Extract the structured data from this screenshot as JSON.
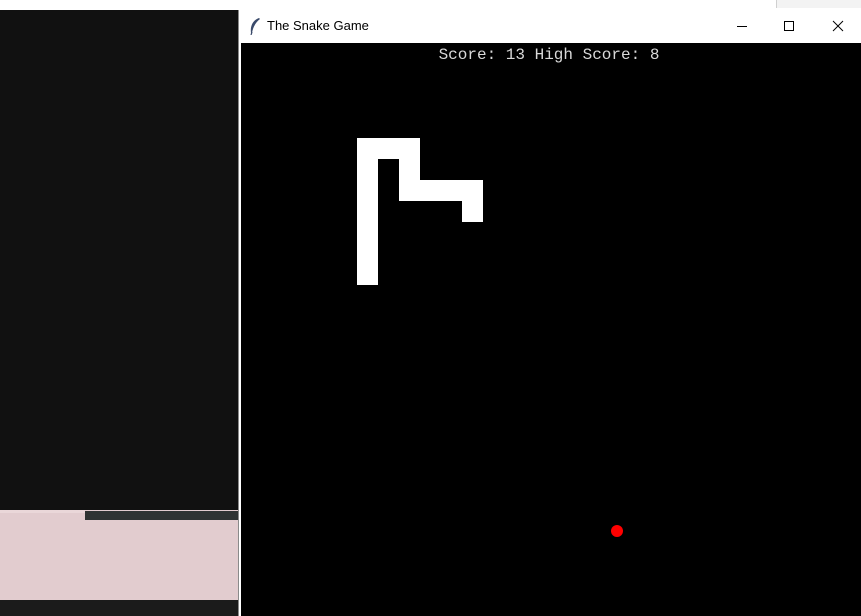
{
  "window": {
    "title": "The Snake Game",
    "icon": "feather-icon",
    "buttons": [
      "minimize-icon",
      "maximize-icon",
      "close-icon"
    ]
  },
  "game": {
    "score_label": "Score:",
    "score": 13,
    "high_score_label": "High Score:",
    "high_score": 8,
    "score_text": "Score: 13 High Score: 8",
    "snake_color": "#ffffff",
    "food_color": "#ff0000",
    "background_color": "#000000"
  }
}
